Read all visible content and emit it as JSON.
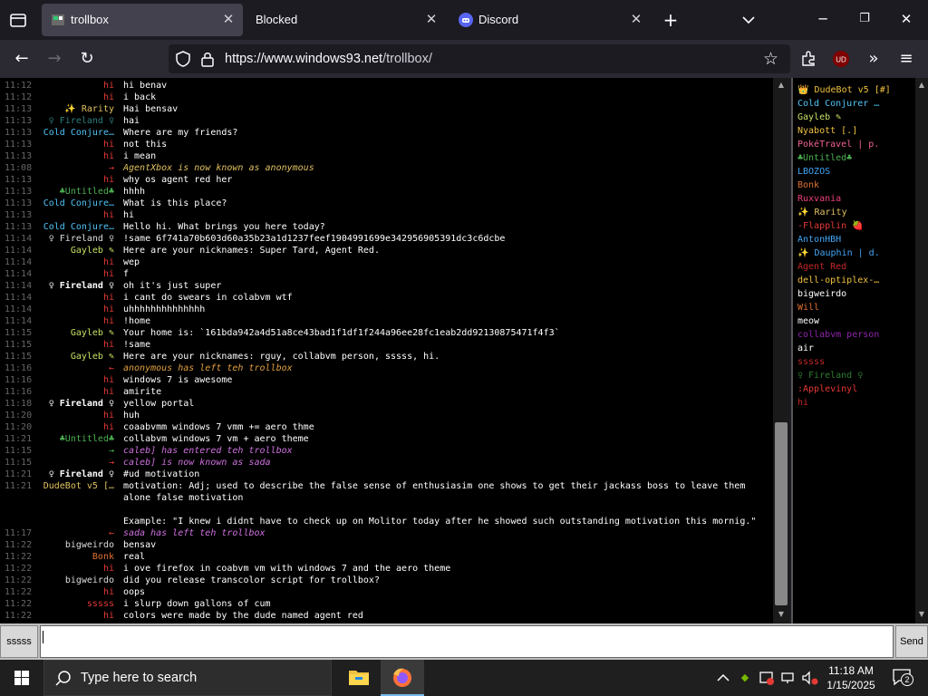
{
  "browser": {
    "tabs": [
      {
        "label": "trollbox",
        "active": true
      },
      {
        "label": "Blocked",
        "active": false
      },
      {
        "label": "Discord",
        "active": false
      }
    ],
    "url_domain": "https://www.windows93.net",
    "url_path": "/trollbox/",
    "ublock_badge": "UD"
  },
  "chat": {
    "messages": [
      {
        "time": "11:12",
        "nick": "hi",
        "nick_color": "#e53935",
        "text": "hi benav"
      },
      {
        "time": "11:12",
        "nick": "hi",
        "nick_color": "#e53935",
        "text": "i  back"
      },
      {
        "time": "11:13",
        "nick": "✨ Rarity",
        "nick_color": "#e0c060",
        "text": "Hai bensav"
      },
      {
        "time": "11:13",
        "nick": "♀ Fireland ♀",
        "nick_color": "#2e7d7d",
        "text": "hai"
      },
      {
        "time": "11:13",
        "nick": "Cold Conjure…",
        "nick_color": "#4fc3f7",
        "text": "Where are my friends?"
      },
      {
        "time": "11:13",
        "nick": "hi",
        "nick_color": "#e53935",
        "text": "not this"
      },
      {
        "time": "11:13",
        "nick": "hi",
        "nick_color": "#e53935",
        "text": "i mean"
      },
      {
        "time": "11:08",
        "nick": "→",
        "nick_color": "#e53935",
        "text": "AgentXbox is now known as anonymous",
        "system": true,
        "text_color": "#e0c060"
      },
      {
        "time": "11:13",
        "nick": "hi",
        "nick_color": "#e53935",
        "text": "why os agent red her"
      },
      {
        "time": "11:13",
        "nick": "♣Untitled♣",
        "nick_color": "#4caf50",
        "text": "hhhh"
      },
      {
        "time": "11:13",
        "nick": "Cold Conjure…",
        "nick_color": "#4fc3f7",
        "text": "What is this place?"
      },
      {
        "time": "11:13",
        "nick": "hi",
        "nick_color": "#e53935",
        "text": "hi"
      },
      {
        "time": "11:13",
        "nick": "Cold Conjure…",
        "nick_color": "#4fc3f7",
        "text": "Hello hi. What brings you here today?"
      },
      {
        "time": "11:14",
        "nick": "♀ Fireland ♀",
        "nick_color": "#dddddd",
        "text": "!same 6f741a70b603d60a35b23a1d1237feef1904991699e342956905391dc3c6dcbe"
      },
      {
        "time": "11:14",
        "nick": "Gayleb ✎",
        "nick_color": "#c5e063",
        "text": "Here are your nicknames: Super Tard, Agent Red."
      },
      {
        "time": "11:14",
        "nick": "hi",
        "nick_color": "#e53935",
        "text": "wep"
      },
      {
        "time": "11:14",
        "nick": "hi",
        "nick_color": "#e53935",
        "text": "f"
      },
      {
        "time": "11:14",
        "nick": "♀ Fireland ♀",
        "nick_color": "#ffffff",
        "bold": true,
        "text": "oh it's just super"
      },
      {
        "time": "11:14",
        "nick": "hi",
        "nick_color": "#e53935",
        "text": "i cant do swears in colabvm wtf"
      },
      {
        "time": "11:14",
        "nick": "hi",
        "nick_color": "#e53935",
        "text": "uhhhhhhhhhhhhhh"
      },
      {
        "time": "11:14",
        "nick": "hi",
        "nick_color": "#e53935",
        "text": "!home"
      },
      {
        "time": "11:15",
        "nick": "Gayleb ✎",
        "nick_color": "#c5e063",
        "text": "Your home is: `161bda942a4d51a8ce43bad1f1df1f244a96ee28fc1eab2dd92130875471f4f3`"
      },
      {
        "time": "11:15",
        "nick": "hi",
        "nick_color": "#e53935",
        "text": "!same"
      },
      {
        "time": "11:15",
        "nick": "Gayleb ✎",
        "nick_color": "#c5e063",
        "text": "Here are your nicknames: rguy, collabvm person, sssss, hi."
      },
      {
        "time": "11:16",
        "nick": "←",
        "nick_color": "#e53935",
        "text": "anonymous has left teh trollbox",
        "system": true,
        "text_color": "#e0a040"
      },
      {
        "time": "11:16",
        "nick": "hi",
        "nick_color": "#e53935",
        "text": "windows 7 is awesome"
      },
      {
        "time": "11:16",
        "nick": "hi",
        "nick_color": "#e53935",
        "text": "amirite"
      },
      {
        "time": "11:18",
        "nick": "♀ Fireland ♀",
        "nick_color": "#ffffff",
        "bold": true,
        "text": "yellow portal"
      },
      {
        "time": "11:20",
        "nick": "hi",
        "nick_color": "#e53935",
        "text": "huh"
      },
      {
        "time": "11:20",
        "nick": "hi",
        "nick_color": "#e53935",
        "text": "coaabvmm windows 7 vmm += aero thme"
      },
      {
        "time": "11:21",
        "nick": "♣Untitled♣",
        "nick_color": "#4caf50",
        "text": "collabvm windows 7 vm + aero theme"
      },
      {
        "time": "11:15",
        "nick": "→",
        "nick_color": "#4caf50",
        "text": "caleb] has entered teh trollbox",
        "system": true,
        "text_color": "#d070e0"
      },
      {
        "time": "11:15",
        "nick": "→",
        "nick_color": "#e53935",
        "text": "caleb] is now known as sada",
        "system": true,
        "text_color": "#d070e0"
      },
      {
        "time": "11:21",
        "nick": "♀ Fireland ♀",
        "nick_color": "#ffffff",
        "bold": true,
        "text": "#ud motivation"
      },
      {
        "time": "11:21",
        "nick": "DudeBot v5 […",
        "nick_color": "#e0c060",
        "text": "motivation: Adj; used to describe the false sense of enthusiasim one shows to get their jackass boss to leave them"
      },
      {
        "time": "",
        "nick": "",
        "nick_color": "#ffffff",
        "text": "alone false motivation"
      },
      {
        "time": "",
        "nick": "",
        "nick_color": "#ffffff",
        "text": ""
      },
      {
        "time": "",
        "nick": "",
        "nick_color": "#ffffff",
        "text": "Example: \"I knew i didnt have to check up on Molitor today after he showed such outstanding motivation this mornig.\""
      },
      {
        "time": "11:17",
        "nick": "←",
        "nick_color": "#e53935",
        "text": "sada has left teh trollbox",
        "system": true,
        "text_color": "#d070e0"
      },
      {
        "time": "11:22",
        "nick": "bigweirdo",
        "nick_color": "#dddddd",
        "text": "bensav"
      },
      {
        "time": "11:22",
        "nick": "Bonk",
        "nick_color": "#e07030",
        "text": "real"
      },
      {
        "time": "11:22",
        "nick": "hi",
        "nick_color": "#e53935",
        "text": "i ove firefox in coabvm vm with windows 7 and the aero theme"
      },
      {
        "time": "11:22",
        "nick": "bigweirdo",
        "nick_color": "#dddddd",
        "text": "did you release transcolor script for trollbox?"
      },
      {
        "time": "11:22",
        "nick": "hi",
        "nick_color": "#e53935",
        "text": "oops"
      },
      {
        "time": "11:22",
        "nick": "sssss",
        "nick_color": "#e53935",
        "text": "i slurp down gallons of cum"
      },
      {
        "time": "11:22",
        "nick": "hi",
        "nick_color": "#e53935",
        "text": "colors were made by the dude named agent red"
      }
    ]
  },
  "userlist": [
    {
      "name": "👑 DudeBot v5 [#]",
      "color": "#f0c040"
    },
    {
      "name": "Cold Conjurer …",
      "color": "#4fc3f7"
    },
    {
      "name": "Gayleb ✎",
      "color": "#c5e063"
    },
    {
      "name": "Nyabott [.]",
      "color": "#f0c040"
    },
    {
      "name": "PokéTravel | p.",
      "color": "#f06292"
    },
    {
      "name": "♣Untitled♣",
      "color": "#4caf50"
    },
    {
      "name": "LBOZOS",
      "color": "#42a5f5"
    },
    {
      "name": "Bonk",
      "color": "#e07030"
    },
    {
      "name": "Ruxvania",
      "color": "#ec407a"
    },
    {
      "name": "✨ Rarity",
      "color": "#e0c060"
    },
    {
      "name": "-Flapplin 🍓",
      "color": "#e53935"
    },
    {
      "name": "AntonHBH",
      "color": "#42a5f5"
    },
    {
      "name": "✨ Dauphin | d.",
      "color": "#42a5f5"
    },
    {
      "name": "Agent Red",
      "color": "#c62828"
    },
    {
      "name": "dell-optiplex-…",
      "color": "#f0c040"
    },
    {
      "name": "bigweirdo",
      "color": "#ffffff"
    },
    {
      "name": "Will",
      "color": "#e07030"
    },
    {
      "name": "meow",
      "color": "#ffffff"
    },
    {
      "name": "collabvm person",
      "color": "#8e24aa"
    },
    {
      "name": "air",
      "color": "#ffffff"
    },
    {
      "name": "sssss",
      "color": "#c62828"
    },
    {
      "name": "♀ Fireland ♀",
      "color": "#2e7d32"
    },
    {
      "name": ":Applevinyl",
      "color": "#e53935"
    },
    {
      "name": "hi",
      "color": "#c62828"
    }
  ],
  "input": {
    "nick_label": "sssss",
    "value": "",
    "send_label": "Send"
  },
  "taskbar": {
    "search_placeholder": "Type here to search",
    "time": "11:18 AM",
    "date": "1/15/2025",
    "notification_count": "2"
  }
}
